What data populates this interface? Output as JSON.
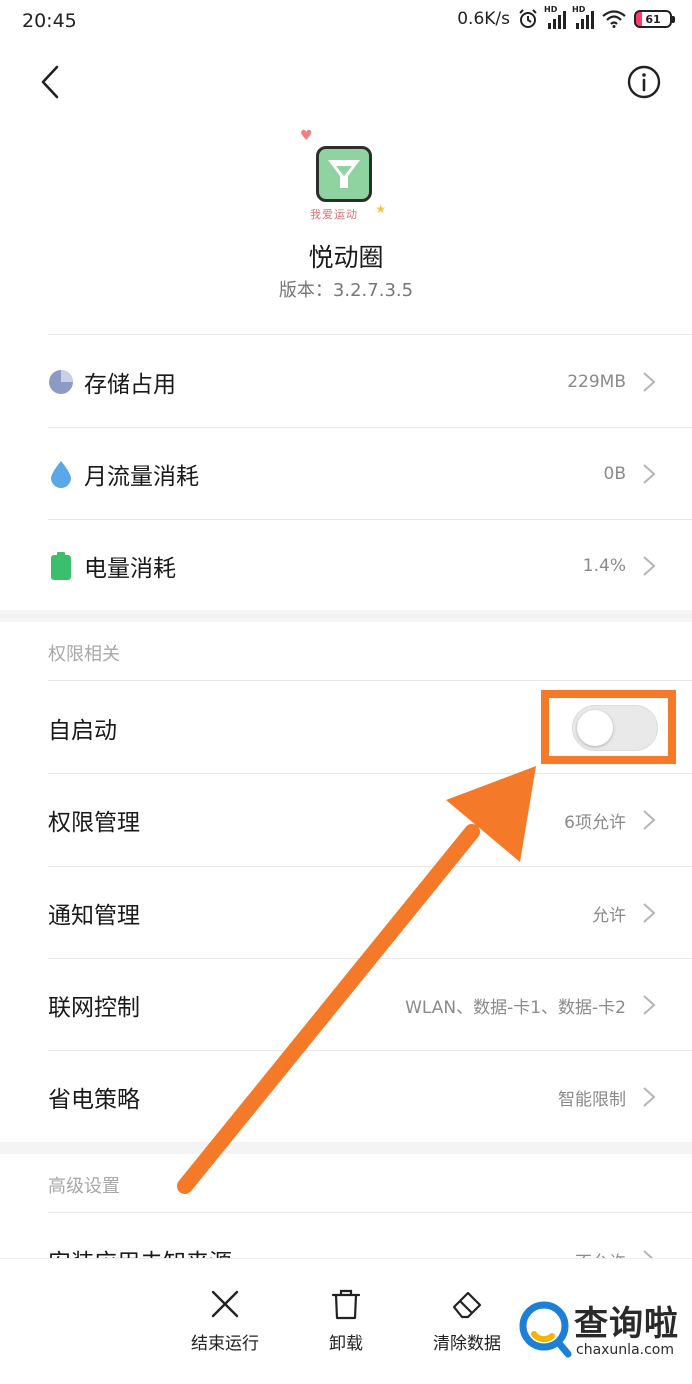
{
  "status_bar": {
    "time": "20:45",
    "net_speed": "0.6K/s",
    "hd_label": "HD",
    "battery_level": "61"
  },
  "app": {
    "name": "悦动圈",
    "version": "版本：3.2.7.3.5",
    "icon_caption": "我爱运动"
  },
  "usage": [
    {
      "label": "存储占用",
      "value": "229MB",
      "icon": "pie-chart-icon",
      "color": "#8d9bc2"
    },
    {
      "label": "月流量消耗",
      "value": "0B",
      "icon": "water-drop-icon",
      "color": "#5aa8e8"
    },
    {
      "label": "电量消耗",
      "value": "1.4%",
      "icon": "battery-icon",
      "color": "#3cbf6c"
    }
  ],
  "permissions": {
    "header": "权限相关",
    "autostart": {
      "label": "自启动",
      "enabled": false
    },
    "items": [
      {
        "label": "权限管理",
        "value": "6项允许"
      },
      {
        "label": "通知管理",
        "value": "允许"
      },
      {
        "label": "联网控制",
        "value": "WLAN、数据-卡1、数据-卡2"
      },
      {
        "label": "省电策略",
        "value": "智能限制"
      }
    ]
  },
  "advanced": {
    "header": "高级设置",
    "items": [
      {
        "label": "安装应用未知来源",
        "value": "不允许"
      }
    ]
  },
  "bottom_actions": [
    {
      "label": "结束运行",
      "icon": "close-icon"
    },
    {
      "label": "卸载",
      "icon": "trash-icon"
    },
    {
      "label": "清除数据",
      "icon": "eraser-icon"
    }
  ],
  "watermark": {
    "cn": "查询啦",
    "en": "chaxunla.com"
  },
  "colors": {
    "accent_orange": "#f47a2a",
    "watermark_blue": "#1e7fd6"
  }
}
